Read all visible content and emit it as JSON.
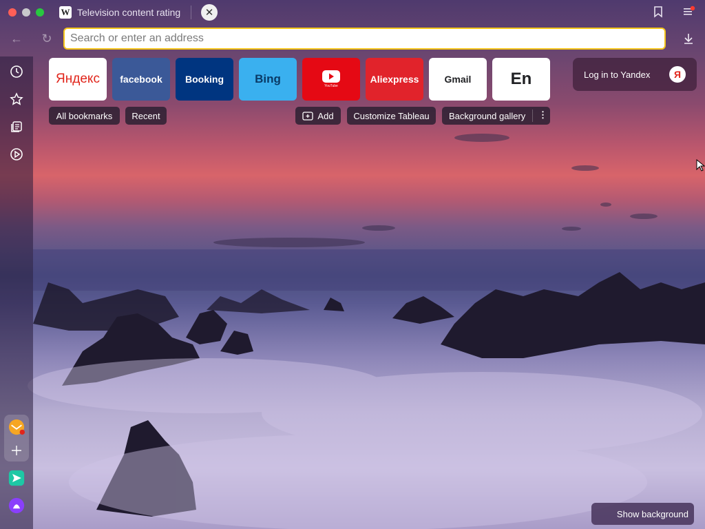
{
  "window": {
    "tab": {
      "title": "Television content rating",
      "favicon_letter": "W"
    },
    "traffic_lights": [
      "#ff5f57",
      "#c8c8cc",
      "#28c840"
    ]
  },
  "toolbar": {
    "address_placeholder": "Search or enter an address",
    "address_value": ""
  },
  "sidebar": {
    "items": [
      {
        "name": "history-icon"
      },
      {
        "name": "bookmarks-star-icon"
      },
      {
        "name": "collections-icon"
      },
      {
        "name": "video-play-icon"
      }
    ],
    "apps": [
      {
        "name": "mail-app-icon"
      },
      {
        "name": "add-app-icon"
      },
      {
        "name": "messenger-app-icon"
      },
      {
        "name": "alice-assistant-icon"
      }
    ]
  },
  "tableau": {
    "tiles": [
      {
        "label": "Яндекс",
        "bg": "#ffffff",
        "color": "#e1251b"
      },
      {
        "label": "facebook",
        "bg": "#3b5998",
        "color": "#ffffff"
      },
      {
        "label": "Booking",
        "bg": "#003580",
        "color": "#ffffff"
      },
      {
        "label": "Bing",
        "bg": "#3ab0ef",
        "color": "#0a3a66"
      },
      {
        "label": "YouTube",
        "bg": "#e50914",
        "color": "#ffffff"
      },
      {
        "label": "Aliexpress",
        "bg": "#e1232b",
        "color": "#ffffff"
      },
      {
        "label": "Gmail",
        "bg": "#ffffff",
        "color": "#202124"
      },
      {
        "label": "En",
        "bg": "#ffffff",
        "color": "#202124"
      }
    ],
    "links": {
      "all_bookmarks": "All bookmarks",
      "recent": "Recent",
      "add": "Add",
      "customize": "Customize Tableau",
      "gallery": "Background gallery"
    }
  },
  "account": {
    "login_label": "Log in to Yandex",
    "logo_letter": "Я"
  },
  "footer": {
    "show_background": "Show background"
  }
}
